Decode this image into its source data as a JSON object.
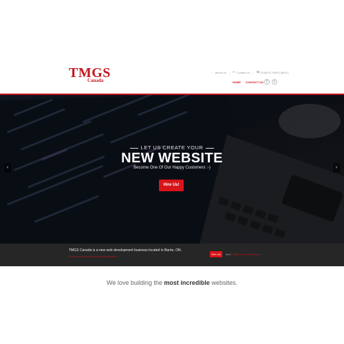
{
  "header": {
    "logo": {
      "main": "TMGS",
      "sub": "Canada"
    },
    "top_links": [
      {
        "label": "About Us",
        "icon": "user-icon"
      },
      {
        "label": "Contact Us",
        "icon": "envelope-icon"
      },
      {
        "label": "(705)970-TMGS (8647)",
        "icon": "phone-icon"
      }
    ],
    "nav": [
      {
        "label": "HOME"
      },
      {
        "label": "CONTACT US"
      }
    ],
    "social": [
      {
        "label": "f",
        "icon": "facebook-icon"
      },
      {
        "label": "t",
        "icon": "twitter-icon"
      }
    ]
  },
  "hero": {
    "pre_title": "LET US CREATE YOUR",
    "title": "NEW WEBSITE",
    "subtitle": "Become One Of Our Happy Customers :-)",
    "cta_label": "Hire Us!",
    "prev_label": "‹",
    "next_label": "›"
  },
  "info_bar": {
    "text": "TMGS Canada is a new web development business located in Barrie, ON.",
    "link": "Contact us today for a free consultation.",
    "button_label": "Hire Us",
    "or_text": "and",
    "side_link": "Follow Us on Facebook"
  },
  "tagline": {
    "before": "We love building the ",
    "bold": "most incredible",
    "after": " websites."
  },
  "colors": {
    "brand_red": "#c4161c",
    "dark_bar": "#262626"
  }
}
